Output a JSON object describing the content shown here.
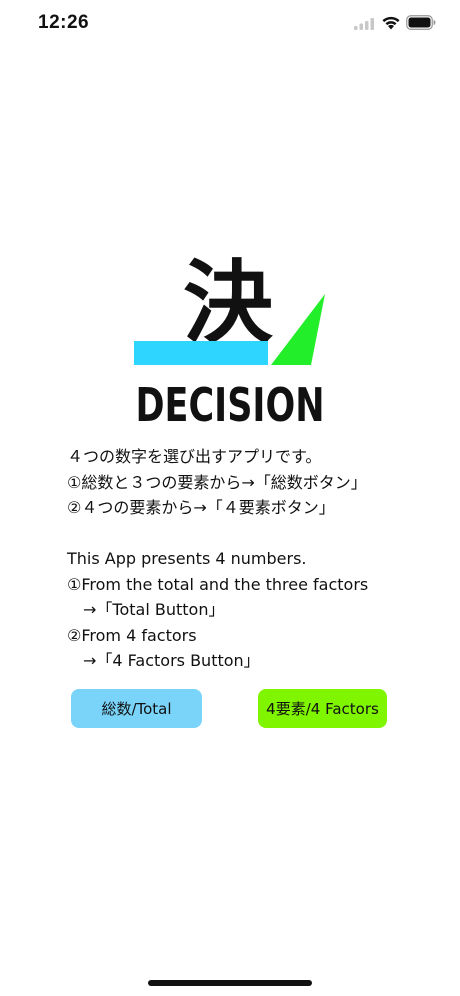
{
  "status_bar": {
    "time": "12:26"
  },
  "logo": {
    "kanji": "決",
    "wordmark": "DECISION",
    "colors": {
      "blue_bar": "#2ED5FF",
      "green_check": "#22EE2A",
      "text": "#111111"
    }
  },
  "description": {
    "jp_line1": "４つの数字を選び出すアプリです。",
    "jp_line2": "①総数と３つの要素から→「総数ボタン」",
    "jp_line3": "②４つの要素から→「４要素ボタン」",
    "en_line1": "This App presents 4 numbers.",
    "en_line2": "①From the total and the three factors",
    "en_line3": "→「Total Button」",
    "en_line4": "②From 4 factors",
    "en_line5": "→「4 Factors Button」"
  },
  "buttons": {
    "total_label": "総数/Total",
    "total_color": "#7AD4FA",
    "factors_label": "4要素/4 Factors",
    "factors_color": "#80F500"
  },
  "icons": [
    "signal-icon",
    "wifi-icon",
    "battery-icon"
  ]
}
